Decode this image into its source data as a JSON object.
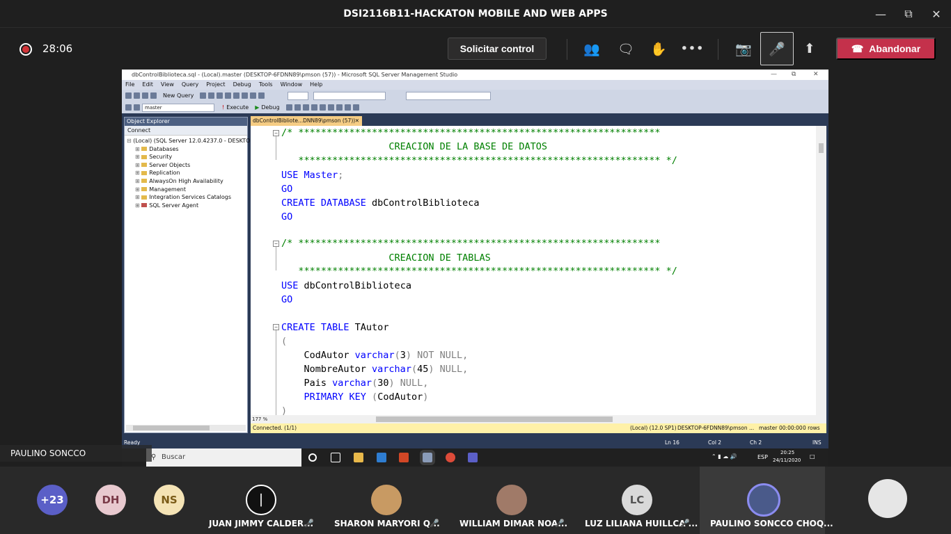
{
  "window": {
    "title": "DSI2116B11-HACKATON MOBILE AND WEB APPS"
  },
  "call": {
    "timer": "28:06",
    "request_control": "Solicitar control",
    "leave": "Abandonar"
  },
  "ssms": {
    "title": "dbControlBiblioteca.sql - (Local).master (DESKTOP-6FDNN89\\pmson (57)) - Microsoft SQL Server Management Studio",
    "menu": [
      "File",
      "Edit",
      "View",
      "Query",
      "Project",
      "Debug",
      "Tools",
      "Window",
      "Help"
    ],
    "toolbar1": {
      "new_query": "New Query"
    },
    "toolbar2": {
      "database": "master",
      "execute": "Execute",
      "debug": "Debug"
    },
    "object_explorer": {
      "header": "Object Explorer",
      "connect": "Connect",
      "root": "(Local) (SQL Server 12.0.4237.0 - DESKTOP-6",
      "nodes": [
        "Databases",
        "Security",
        "Server Objects",
        "Replication",
        "AlwaysOn High Availability",
        "Management",
        "Integration Services Catalogs",
        "SQL Server Agent"
      ]
    },
    "tab": "dbControlBibliote...DNN89\\pmson (57))",
    "zoom": "177 %",
    "code": {
      "l1": "/* ****************************************************************",
      "l2": "                   CREACION DE LA BASE DE DATOS",
      "l3": "   **************************************************************** */",
      "l4a": "USE",
      "l4b": " Master",
      "l4c": ";",
      "l5": "GO",
      "l6a": "CREATE DATABASE",
      "l6b": " dbControlBiblioteca",
      "l7": "GO",
      "l8": "/* ****************************************************************",
      "l9": "                   CREACION DE TABLAS",
      "l10": "   **************************************************************** */",
      "l11a": "USE",
      "l11b": " dbControlBiblioteca",
      "l12": "GO",
      "l13a": "CREATE TABLE",
      "l13b": " TAutor",
      "l14": "(",
      "l15a": "    CodAutor ",
      "l15b": "varchar",
      "l15c": "(",
      "l15d": "3",
      "l15e": ") NOT NULL,",
      "l16a": "    NombreAutor ",
      "l16b": "varchar",
      "l16c": "(",
      "l16d": "45",
      "l16e": ") NULL,",
      "l17a": "    Pais ",
      "l17b": "varchar",
      "l17c": "(",
      "l17d": "30",
      "l17e": ") NULL,",
      "l18a": "    PRIMARY KEY",
      "l18b": " (",
      "l18c": "CodAutor",
      "l18d": ")",
      "l19": ")"
    },
    "connection": {
      "status": "Connected. (1/1)",
      "server": "(Local) (12.0 SP1)",
      "user": "DESKTOP-6FDNN89\\pmson ...",
      "db": "master",
      "time": "00:00:00",
      "rows": "0 rows"
    },
    "status": {
      "ready": "Ready",
      "ln": "Ln 16",
      "col": "Col 2",
      "ch": "Ch 2",
      "ins": "INS"
    }
  },
  "taskbar": {
    "search": "Buscar",
    "lang": "ESP",
    "time": "20:25",
    "date": "24/11/2020"
  },
  "presenter": "PAULINO SONCCO CHOQUEHUANCA",
  "participants": {
    "overflow": "+23",
    "initials": [
      "DH",
      "NS",
      "LC"
    ],
    "names": [
      "JUAN JIMMY CALDER...",
      "SHARON MARYORI Q...",
      "WILLIAM DIMAR NOA...",
      "LUZ LILIANA HUILLCA ...",
      "PAULINO SONCCO CHOQ..."
    ]
  },
  "colors": {
    "leave": "#c4314b",
    "keyword": "#0000ff",
    "comment": "#008000",
    "tab_active": "#f5cc84"
  }
}
